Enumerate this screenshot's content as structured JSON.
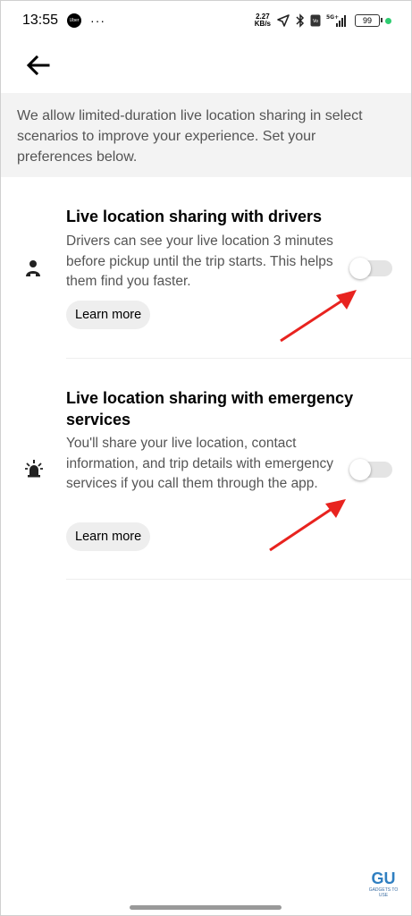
{
  "status_bar": {
    "time": "13:55",
    "notification_app": "Uber",
    "more_dots": "···",
    "speed_value": "2.27",
    "speed_unit": "KB/s",
    "network": "5G+",
    "battery": "99",
    "icons": [
      "uber-icon",
      "location-arrow-icon",
      "bluetooth-icon",
      "volte-icon",
      "signal-icon",
      "battery-icon"
    ]
  },
  "header": {
    "back_icon": "arrow-left-icon"
  },
  "intro_text": "We allow limited-duration live location sharing in select scenarios to improve your experience. Set  your preferences below.",
  "settings": [
    {
      "icon": "person-icon",
      "title": "Live location sharing with drivers",
      "description": "Drivers can see your live location 3 minutes before pickup until the trip starts. This helps them find you faster.",
      "button": "Learn more",
      "toggle_on": false
    },
    {
      "icon": "emergency-siren-icon",
      "title": "Live location sharing with emergency services",
      "description": "You'll share your live location, contact information, and trip details with emergency services if you call them through the app.",
      "button": "Learn more",
      "toggle_on": false
    }
  ],
  "colors": {
    "annotation_arrow": "#e8231f",
    "intro_background": "#f3f3f3",
    "toggle_track": "#e4e4e4"
  },
  "watermark": {
    "logo": "GU",
    "tagline": "GADGETS TO USE"
  }
}
